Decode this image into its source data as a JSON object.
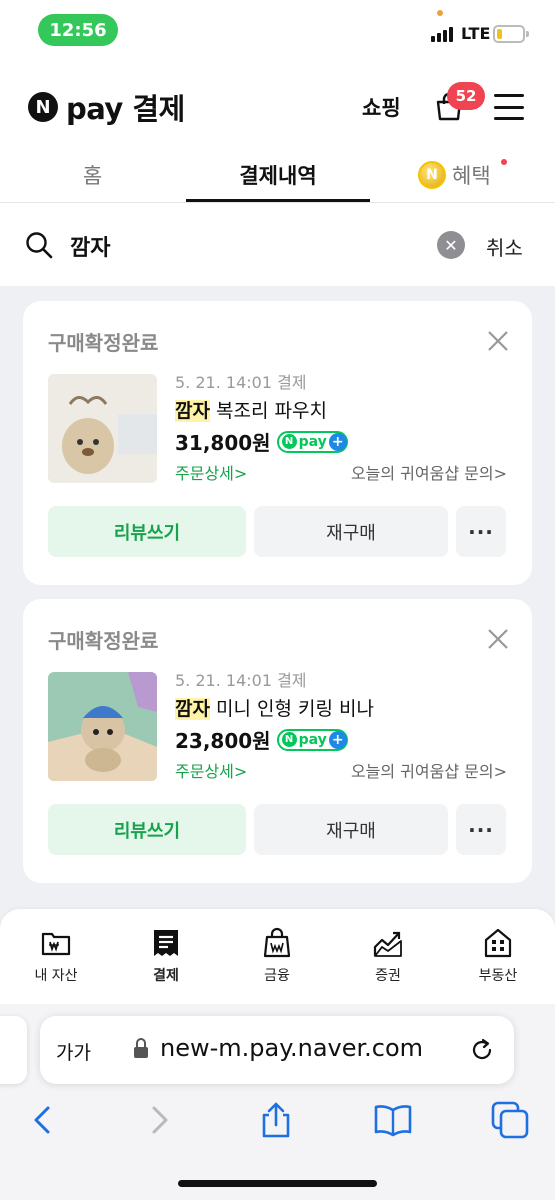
{
  "status_bar": {
    "time": "12:56",
    "network": "LTE"
  },
  "header": {
    "logo_mark": "N",
    "logo_text": "pay 결제",
    "shopping_label": "쇼핑",
    "cart_count": "52"
  },
  "tabs": [
    {
      "label": "홈"
    },
    {
      "label": "결제내역",
      "active": true
    },
    {
      "label": "혜택",
      "icon": "coin-icon",
      "coin_mark": "N",
      "has_new_dot": true
    }
  ],
  "search": {
    "value": "깜자",
    "cancel_label": "취소"
  },
  "orders": [
    {
      "status": "구매확정완료",
      "meta": "5. 21. 14:01 결제",
      "keyword": "깜자",
      "name_rest": " 복조리 파우치",
      "price": "31,800원",
      "pay_badge_n": "N",
      "pay_badge_text": "pay",
      "pay_badge_plus": "+",
      "detail_link": "주문상세",
      "inquiry_link": "오늘의 귀여움샵 문의",
      "review_label": "리뷰쓰기",
      "rebuy_label": "재구매",
      "more_label": "···"
    },
    {
      "status": "구매확정완료",
      "meta": "5. 21. 14:01 결제",
      "keyword": "깜자",
      "name_rest": " 미니 인형 키링 비나",
      "price": "23,800원",
      "pay_badge_n": "N",
      "pay_badge_text": "pay",
      "pay_badge_plus": "+",
      "detail_link": "주문상세",
      "inquiry_link": "오늘의 귀여움샵 문의",
      "review_label": "리뷰쓰기",
      "rebuy_label": "재구매",
      "more_label": "···"
    }
  ],
  "bottom_nav": [
    {
      "label": "내 자산",
      "icon": "wallet-icon"
    },
    {
      "label": "결제",
      "icon": "receipt-icon",
      "active": true
    },
    {
      "label": "금융",
      "icon": "money-bag-icon"
    },
    {
      "label": "증권",
      "icon": "stock-chart-icon"
    },
    {
      "label": "부동산",
      "icon": "building-icon"
    }
  ],
  "browser": {
    "text_size_label": "가가",
    "url": "new-m.pay.naver.com"
  },
  "colors": {
    "naver_green": "#03c75a",
    "badge_red": "#f04452",
    "status_green": "#34c759",
    "review_bg": "#e5f6ea",
    "link_green": "#19a24d",
    "highlight_yellow": "#fff3a8"
  }
}
